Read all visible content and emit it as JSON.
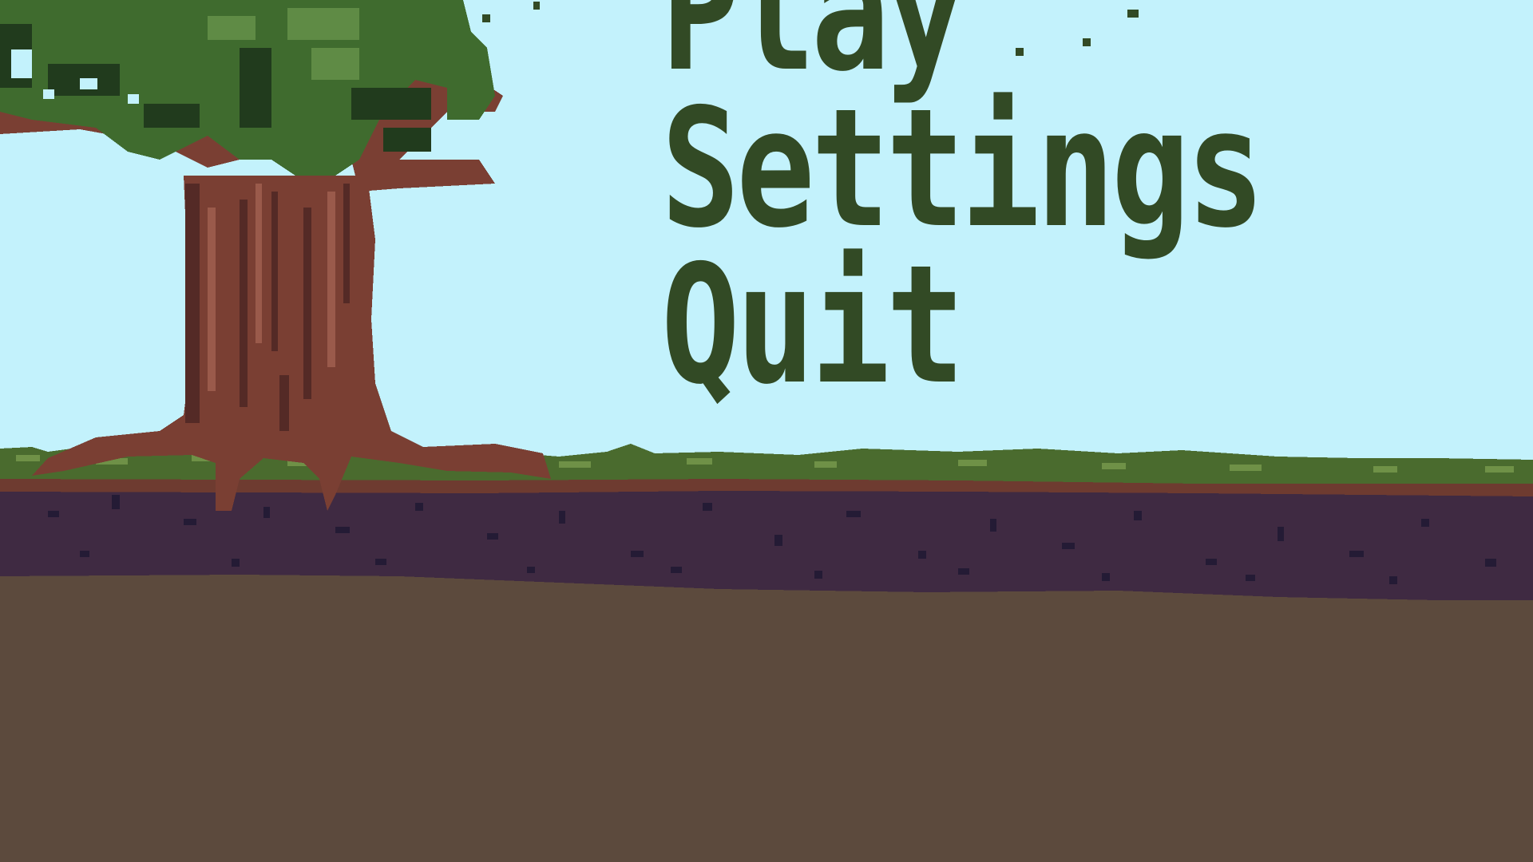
{
  "menu": {
    "play": "Play",
    "settings": "Settings",
    "quit": "Quit"
  },
  "colors": {
    "sky": "#c3f2fc",
    "text": "#324a25",
    "grass": "#4a6b2e",
    "topsoil": "#6e3b30",
    "darksoil": "#3f2a42",
    "underground": "#5c4a3d",
    "trunk": "#7a3f33",
    "leaves": "#3f6b2e"
  }
}
